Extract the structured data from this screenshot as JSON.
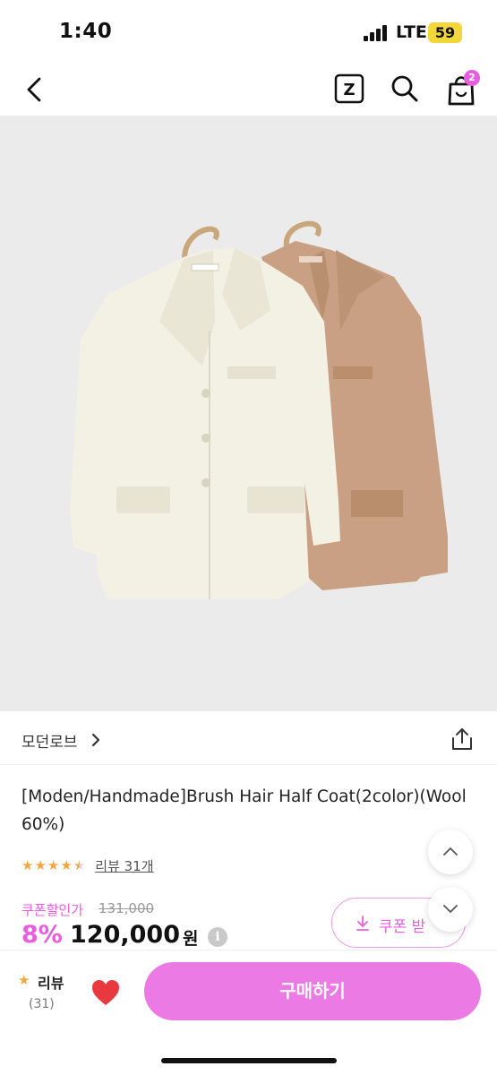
{
  "status_bar": {
    "time": "1:40",
    "network": "LTE",
    "battery": "59"
  },
  "nav": {
    "cart_count": "2",
    "z_label": "Z"
  },
  "product": {
    "brand": "모던로브",
    "title": "[Moden/Handmade]Brush Hair Half Coat(2color)(Wool 60%)",
    "rating": 4.5,
    "review_link": "리뷰 31개",
    "coupon_label": "쿠폰할인가",
    "original_price": "131,000",
    "discount": "8%",
    "price": "120,000",
    "currency": "원",
    "info_glyph": "i"
  },
  "coupon_button": {
    "label": "쿠폰 받"
  },
  "bottom_bar": {
    "review_label": "리뷰",
    "review_count": "(31)",
    "buy_label": "구매하기"
  },
  "colors": {
    "accent": "#ec7ae4",
    "star": "#f3a741",
    "heart": "#e8393f"
  }
}
